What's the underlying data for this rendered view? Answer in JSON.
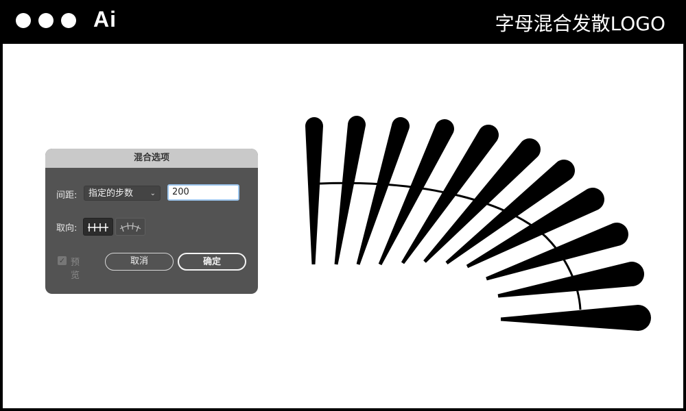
{
  "header": {
    "app_label": "Ai",
    "page_title": "字母混合发散LOGO"
  },
  "dialog": {
    "title": "混合选项",
    "spacing_label": "间距:",
    "spacing_mode": "指定的步数",
    "spacing_steps_value": "200",
    "orientation_label": "取向:",
    "orientation_options": [
      "align-to-page-icon",
      "align-to-path-icon"
    ],
    "orientation_selected": "align-to-page-icon",
    "preview_label": "预览",
    "preview_checked": true,
    "cancel_label": "取消",
    "ok_label": "确定"
  },
  "colors": {
    "topbar": "#000000",
    "canvas": "#ffffff",
    "dialog_bg": "#535353",
    "dialog_title_bg": "#c9c9c9",
    "input_focus": "#9cc6ee"
  }
}
